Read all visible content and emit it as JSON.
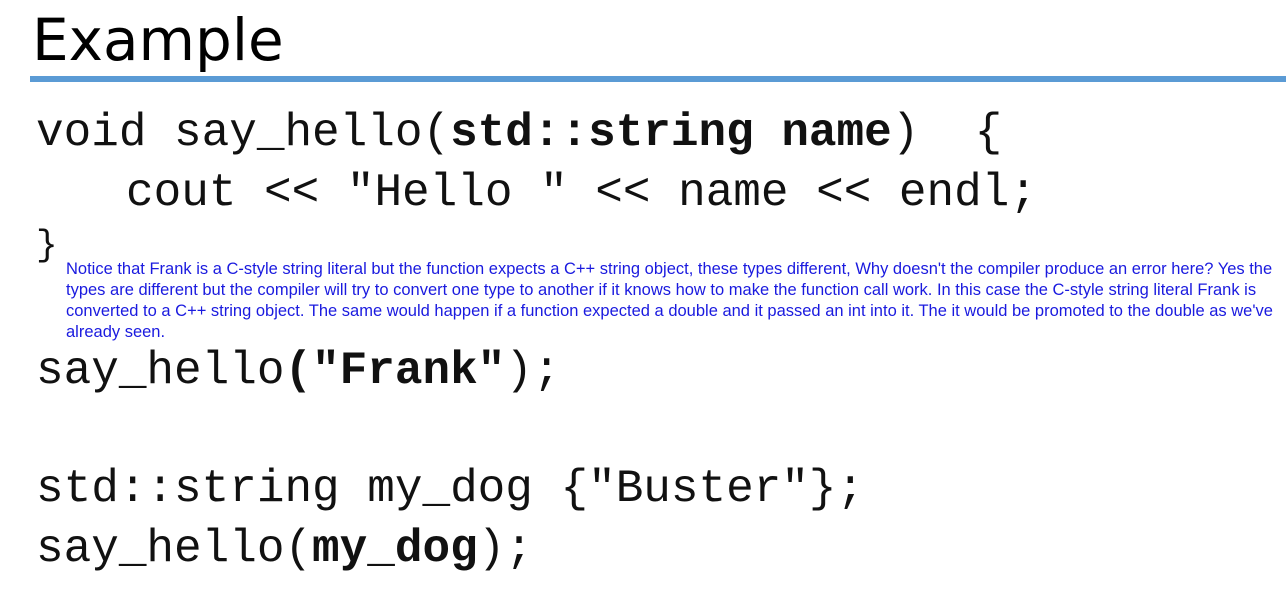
{
  "title": "Example",
  "code": {
    "line1": {
      "prefix": "void say_hello(",
      "bold": "std::string name",
      "suffix": ")  {"
    },
    "line2": "cout << \"Hello \" << name << endl;",
    "line3": "}",
    "line4": {
      "prefix": "say_hello",
      "bold": "(\"Frank\"",
      "suffix": ");"
    },
    "line5": "std::string my_dog {\"Buster\"};",
    "line6": {
      "prefix": "say_hello(",
      "bold": "my_dog",
      "suffix": ");"
    }
  },
  "note": "Notice that Frank is a C-style string literal but the function expects a C++ string object, these types different, Why doesn't the compiler produce an error here? Yes the types are different but the compiler will try to convert one type to another if it knows how to make the function call work. In this case the C-style string literal Frank is converted to a C++ string object. The same would happen if a function expected a double and it passed an int into it. The it would be promoted to the double as we've already seen.",
  "colors": {
    "accent_rule": "#5b9bd5",
    "note_text": "#1a1adf"
  }
}
